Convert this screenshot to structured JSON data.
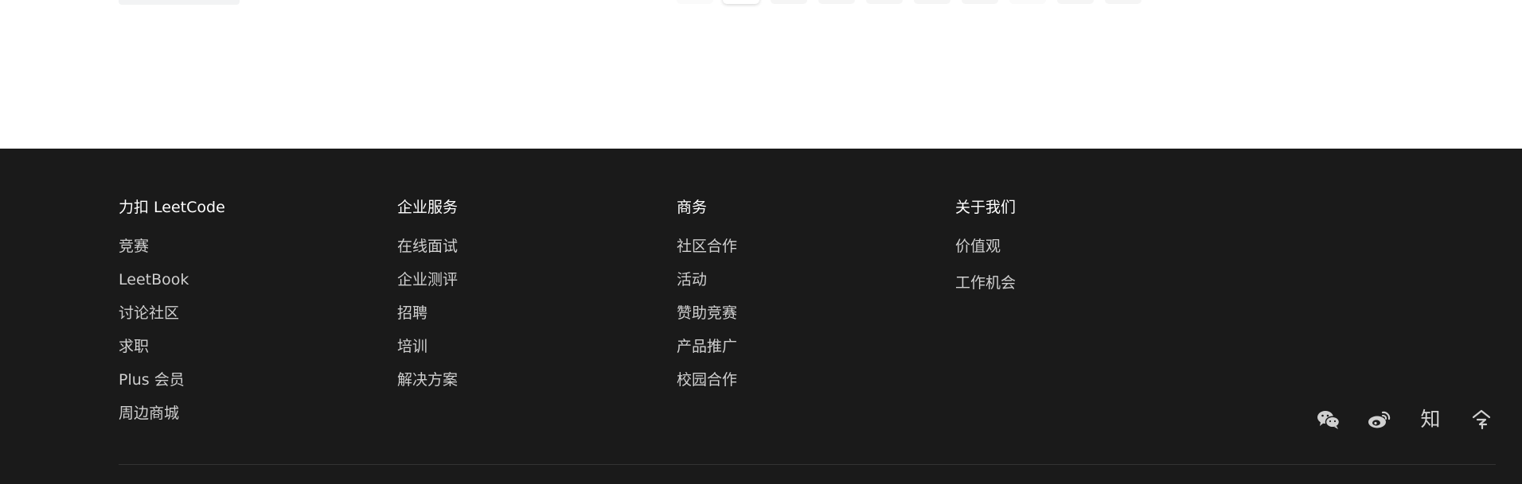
{
  "footer": {
    "columns": [
      {
        "title": "力扣 LeetCode",
        "links": [
          "竞赛",
          "LeetBook",
          "讨论社区",
          "求职",
          "Plus 会员",
          "周边商城"
        ]
      },
      {
        "title": "企业服务",
        "links": [
          "在线面试",
          "企业测评",
          "招聘",
          "培训",
          "解决方案"
        ]
      },
      {
        "title": "商务",
        "links": [
          "社区合作",
          "活动",
          "赞助竞赛",
          "产品推广",
          "校园合作"
        ]
      },
      {
        "title": "关于我们",
        "links": [
          "价值观",
          "工作机会"
        ]
      }
    ],
    "social": {
      "wechat_icon": "wechat-icon",
      "weibo_icon": "weibo-icon",
      "zhihu_label": "知",
      "other_icon": "toutiao-icon"
    }
  },
  "colors": {
    "footer_bg": "#1a1a1a",
    "title_text": "#ffffff",
    "link_text": "#cfcfcf",
    "page_bg": "#ffffff"
  }
}
